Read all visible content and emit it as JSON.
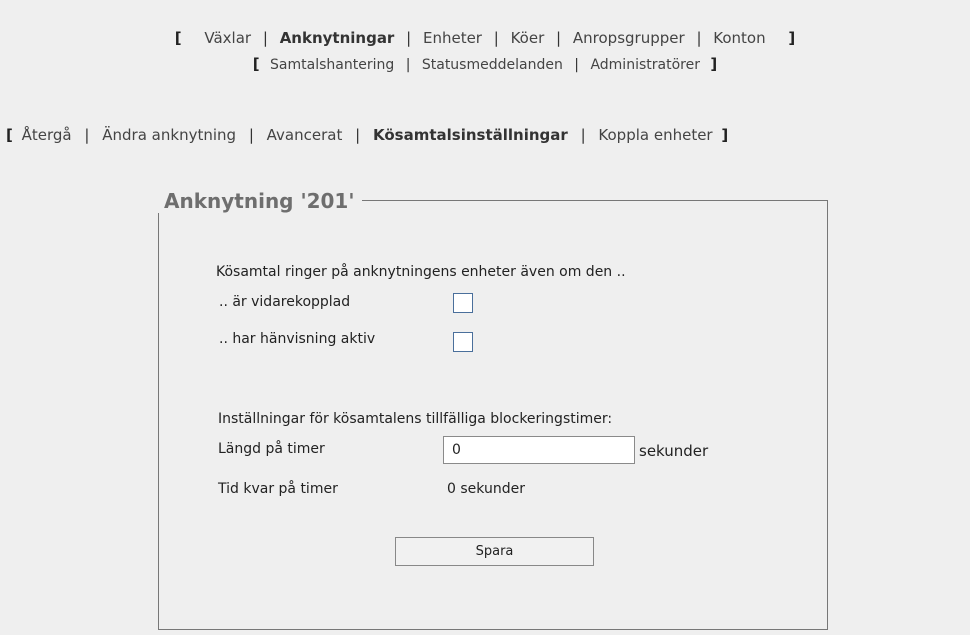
{
  "nav_main": {
    "row1": [
      "Växlar",
      "Anknytningar",
      "Enheter",
      "Köer",
      "Anropsgrupper",
      "Konton"
    ],
    "row2": [
      "Samtalshantering",
      "Statusmeddelanden",
      "Administratörer"
    ],
    "active": "Anknytningar"
  },
  "nav_sub": {
    "items": [
      "Återgå",
      "Ändra anknytning",
      "Avancerat",
      "Kösamtalsinställningar",
      "Koppla enheter"
    ],
    "active": "Kösamtalsinställningar"
  },
  "brackets": {
    "open": "[",
    "close": "]",
    "separator": "|"
  },
  "panel": {
    "title": "Anknytning '201'",
    "intro": "Kösamtal ringer på anknytningens enheter även om den ..",
    "option_forwarded_label": ".. är vidarekopplad",
    "option_forwarded_checked": false,
    "option_redirect_label": ".. har hänvisning aktiv",
    "option_redirect_checked": false,
    "timer_heading": "Inställningar för kösamtalens tillfälliga blockeringstimer:",
    "timer_length_label": "Längd på timer",
    "timer_length_value": "0",
    "timer_length_unit": "sekunder",
    "timer_left_label": "Tid kvar på timer",
    "timer_left_value": "0 sekunder",
    "save_label": "Spara"
  }
}
